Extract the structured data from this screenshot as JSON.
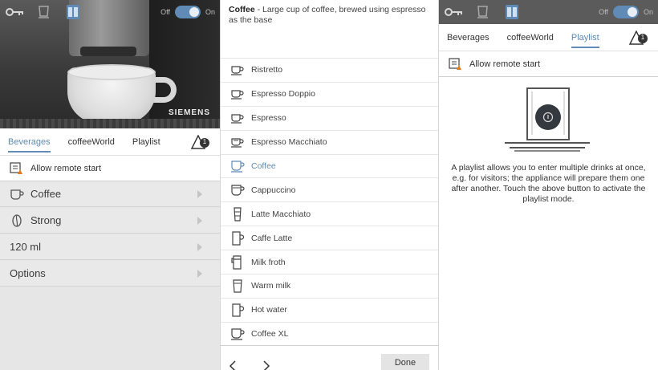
{
  "toolbar": {
    "off_label": "Off",
    "on_label": "On"
  },
  "hero": {
    "brand": "SIEMENS"
  },
  "tabs": [
    {
      "label": "Beverages"
    },
    {
      "label": "coffeeWorld"
    },
    {
      "label": "Playlist"
    }
  ],
  "alert": {
    "count": "1"
  },
  "remote": {
    "label": "Allow remote start"
  },
  "settings": [
    {
      "label": "Coffee",
      "icon": "cup-icon"
    },
    {
      "label": "Strong",
      "icon": "bean-icon"
    },
    {
      "label": "120 ml"
    },
    {
      "label": "Options"
    }
  ],
  "beverage_desc": {
    "name": "Coffee",
    "text": " - Large cup of coffee, brewed using espresso as the base"
  },
  "beverages": [
    {
      "label": "Ristretto",
      "icon": "espresso-cup-icon"
    },
    {
      "label": "Espresso Doppio",
      "icon": "espresso-cup-icon"
    },
    {
      "label": "Espresso",
      "icon": "espresso-cup-icon"
    },
    {
      "label": "Espresso Macchiato",
      "icon": "espresso-cup-icon"
    },
    {
      "label": "Coffee",
      "icon": "coffee-cup-icon"
    },
    {
      "label": "Cappuccino",
      "icon": "cappuccino-cup-icon"
    },
    {
      "label": "Latte Macchiato",
      "icon": "glass-icon"
    },
    {
      "label": "Caffe Latte",
      "icon": "mug-icon"
    },
    {
      "label": "Milk froth",
      "icon": "jug-icon"
    },
    {
      "label": "Warm milk",
      "icon": "glass-icon"
    },
    {
      "label": "Hot water",
      "icon": "mug-icon"
    },
    {
      "label": "Coffee XL",
      "icon": "coffee-cup-icon"
    }
  ],
  "footer": {
    "done_label": "Done"
  },
  "playlist": {
    "description": "A playlist allows you to enter multiple drinks at once, e.g. for visitors; the appliance will prepare them one after another. Touch the above button to activate the playlist mode."
  },
  "colors": {
    "accent": "#5f8bb6",
    "toggle": "#5f8bb6"
  }
}
